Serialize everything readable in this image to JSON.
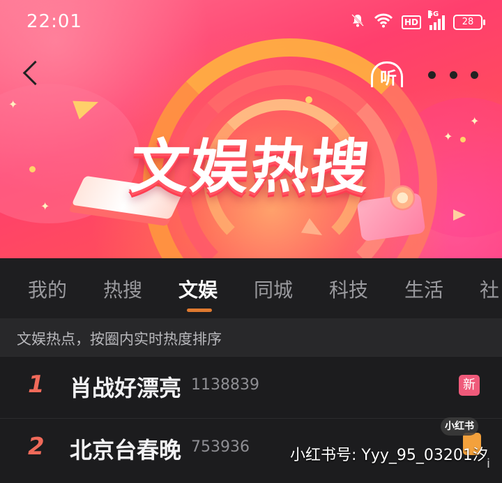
{
  "status_bar": {
    "time": "22:01",
    "network": "5G",
    "hd_label": "HD",
    "battery": "28"
  },
  "banner": {
    "title": "文娱热搜"
  },
  "nav": {
    "listen_label": "听"
  },
  "tabs": [
    "我的",
    "热搜",
    "文娱",
    "同城",
    "科技",
    "生活",
    "社"
  ],
  "active_tab": "文娱",
  "subtitle": "文娱热点，按圈内实时热度排序",
  "items": [
    {
      "rank": "1",
      "title": "肖战好漂亮",
      "heat": "1138839",
      "badge": "新",
      "badge_color": "#ef5a7a"
    },
    {
      "rank": "2",
      "title": "北京台春晚",
      "heat": "753936",
      "badge_color": "#f3a13c"
    }
  ],
  "watermark": {
    "logo": "小红书",
    "text": "小红书号: Yyy_95_03201汐",
    "extra": "i"
  },
  "colors": {
    "accent": "#e07a30",
    "rank": "#f06a5a",
    "background": "#1c1c1e"
  }
}
